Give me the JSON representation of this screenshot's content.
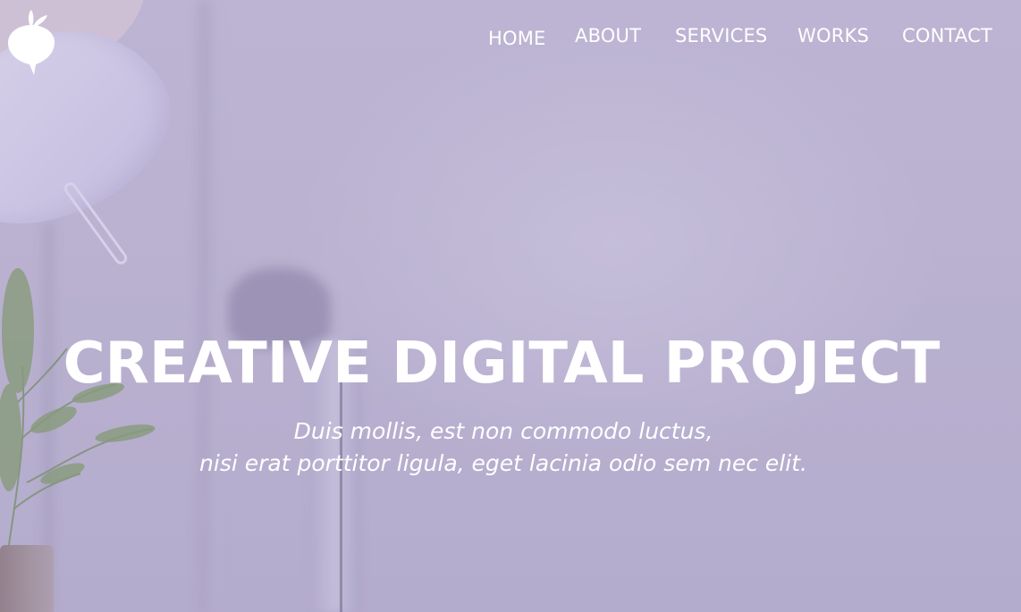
{
  "nav": {
    "items": [
      {
        "label": "HOME"
      },
      {
        "label": "ABOUT"
      },
      {
        "label": "SERVICES"
      },
      {
        "label": "WORKS"
      },
      {
        "label": "CONTACT"
      }
    ]
  },
  "hero": {
    "title": "CREATIVE DIGITAL PROJECT",
    "subtitle_line1": "Duis mollis, est non commodo luctus,",
    "subtitle_line2": "nisi erat porttitor ligula, eget lacinia odio sem nec elit."
  },
  "logo": {
    "icon": "beet-logo-icon"
  },
  "colors": {
    "background": "#b9b0ce",
    "text": "#ffffff"
  }
}
